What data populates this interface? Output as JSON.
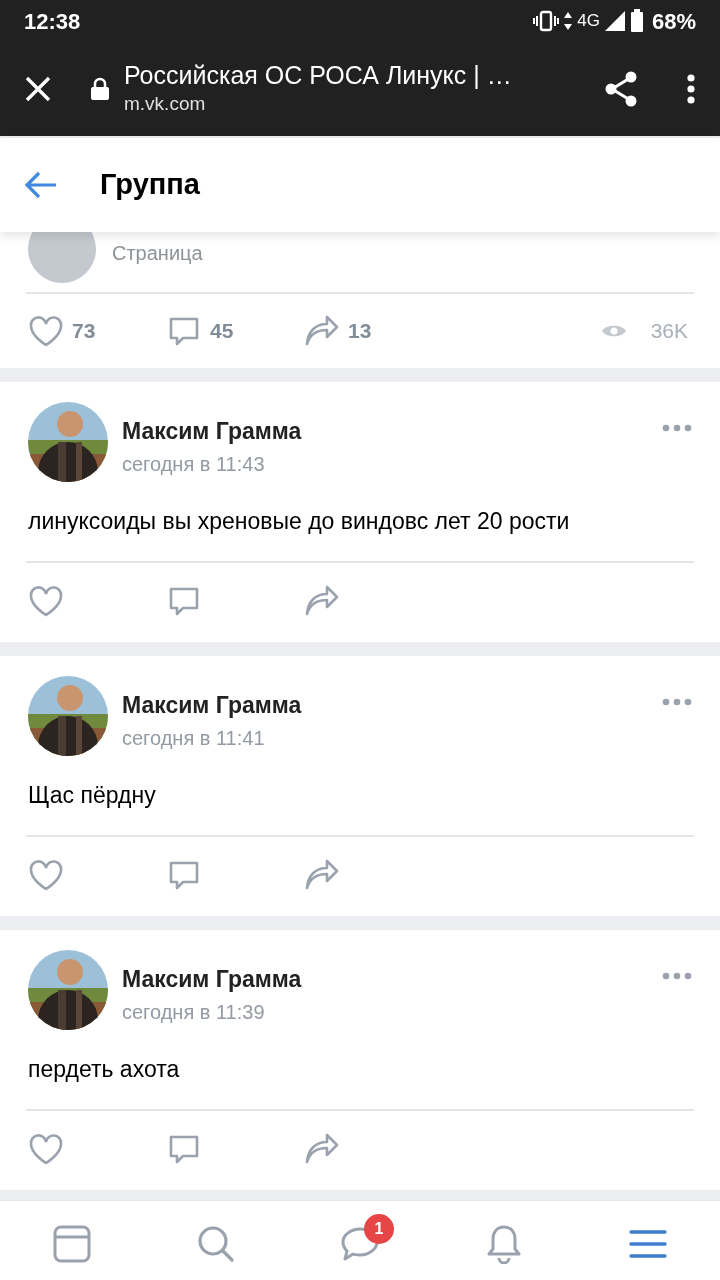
{
  "status_bar": {
    "time": "12:38",
    "network": "4G",
    "battery": "68%"
  },
  "browser_bar": {
    "title": "Российская ОС РОСА Линукс | …",
    "url": "m.vk.com"
  },
  "header": {
    "title": "Группа"
  },
  "link_card": {
    "subtitle": "Страница",
    "likes": "73",
    "comments": "45",
    "shares": "13",
    "views": "36K"
  },
  "posts": [
    {
      "author": "Максим Грамма",
      "time": "сегодня в 11:43",
      "text": "линуксоиды вы хреновые до виндовс лет 20 рости"
    },
    {
      "author": "Максим Грамма",
      "time": "сегодня в 11:41",
      "text": "Щас пёрдну"
    },
    {
      "author": "Максим Грамма",
      "time": "сегодня в 11:39",
      "text": "пердеть ахота"
    }
  ],
  "tab_bar": [
    {
      "kind": "feed",
      "selected": false
    },
    {
      "kind": "search",
      "selected": false
    },
    {
      "kind": "messages",
      "selected": false,
      "badge": "1"
    },
    {
      "kind": "notifications",
      "selected": false
    },
    {
      "kind": "menu",
      "selected": true
    }
  ]
}
